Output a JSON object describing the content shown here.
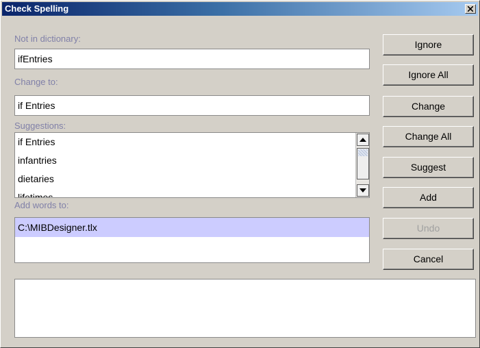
{
  "window": {
    "title": "Check Spelling"
  },
  "not_in_dictionary": {
    "label": "Not in dictionary:",
    "value": "ifEntries"
  },
  "change_to": {
    "label": "Change to:",
    "value": "if Entries"
  },
  "suggestions": {
    "label": "Suggestions:",
    "items": [
      "if Entries",
      "infantries",
      "dietaries",
      "lifetimes"
    ]
  },
  "add_words_to": {
    "label": "Add words to:",
    "items": [
      "C:\\MIBDesigner.tlx"
    ],
    "selected_index": 0
  },
  "buttons": {
    "ignore": "Ignore",
    "ignore_all": "Ignore All",
    "change": "Change",
    "change_all": "Change All",
    "suggest": "Suggest",
    "add": "Add",
    "undo": "Undo",
    "cancel": "Cancel"
  },
  "message": "",
  "colors": {
    "title_gradient_start": "#0a246a",
    "title_gradient_end": "#a6caf0",
    "label_text": "#8080a8",
    "selection": "#ccccff",
    "disabled_text": "#a0a0a0"
  }
}
